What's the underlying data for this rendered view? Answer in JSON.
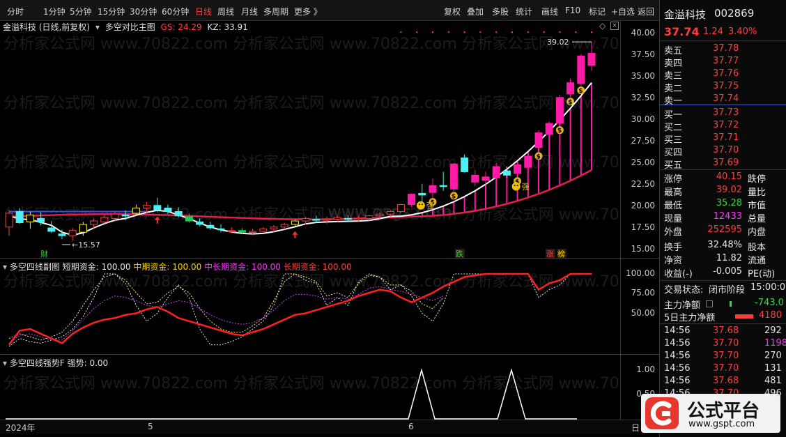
{
  "toolbar": {
    "periods": [
      "分时",
      "1分钟",
      "5分钟",
      "15分钟",
      "30分钟",
      "60分钟",
      "日线",
      "周线",
      "月线",
      "多周期",
      "更多 》"
    ],
    "active_period": "日线",
    "actions": [
      "复权",
      "叠加",
      "多股",
      "统计",
      "画线",
      "F10",
      "标记",
      "+自选",
      "返回"
    ]
  },
  "main_chart": {
    "stock_label": "金溢科技 (日线,前复权)",
    "indicator_name": "多空对比主图",
    "gs_label": "GS: 24.29",
    "kz_label": "KZ: 33.91",
    "high_marker": "39.02",
    "low_marker": "15.57",
    "qiang_label": "强",
    "y_ticks": [
      "40.00",
      "37.50",
      "35.00",
      "32.50",
      "30.00",
      "27.50",
      "25.00",
      "22.50",
      "20.00",
      "17.50",
      "15.00"
    ],
    "y_range": [
      15.0,
      40.0
    ],
    "event_labels": [
      "财",
      "跌",
      "涨",
      "榜"
    ],
    "watermark": "分析家公式网 www.70822.com",
    "watermark2": "www.gsgs.com",
    "candles": [
      [
        17.6,
        19.6,
        16.6,
        19.2
      ],
      [
        19.4,
        19.8,
        18.0,
        18.1
      ],
      [
        18.2,
        19.4,
        17.4,
        19.0
      ],
      [
        18.6,
        19.3,
        17.8,
        18.2
      ],
      [
        17.5,
        18.3,
        16.9,
        17.1
      ],
      [
        16.8,
        17.3,
        16.2,
        16.6
      ],
      [
        16.6,
        17.5,
        16.0,
        17.2
      ],
      [
        17.0,
        18.2,
        16.6,
        17.9
      ],
      [
        17.9,
        18.6,
        17.4,
        18.3
      ],
      [
        18.2,
        19.0,
        17.8,
        18.7
      ],
      [
        18.6,
        19.4,
        18.2,
        19.1
      ],
      [
        19.0,
        19.5,
        18.4,
        18.9
      ],
      [
        19.2,
        20.2,
        18.9,
        19.8
      ],
      [
        19.8,
        20.5,
        19.2,
        20.1
      ],
      [
        20.1,
        21.0,
        19.3,
        19.6
      ],
      [
        19.8,
        20.2,
        19.1,
        19.4
      ],
      [
        19.4,
        19.9,
        18.7,
        18.9
      ],
      [
        18.8,
        19.2,
        18.1,
        18.3
      ],
      [
        18.2,
        18.6,
        17.7,
        17.9
      ],
      [
        17.8,
        18.2,
        17.3,
        17.5
      ],
      [
        17.4,
        17.9,
        17.0,
        17.3
      ],
      [
        17.2,
        17.6,
        16.9,
        17.2
      ],
      [
        17.2,
        17.5,
        16.8,
        17.0
      ],
      [
        17.0,
        17.4,
        16.7,
        17.1
      ],
      [
        17.1,
        17.6,
        16.9,
        17.4
      ],
      [
        17.4,
        17.8,
        17.0,
        17.6
      ],
      [
        17.6,
        18.1,
        17.3,
        17.9
      ],
      [
        17.9,
        18.5,
        17.6,
        18.3
      ],
      [
        18.3,
        18.8,
        17.9,
        18.6
      ],
      [
        18.5,
        18.9,
        18.1,
        18.4
      ],
      [
        18.4,
        18.8,
        18.0,
        18.5
      ],
      [
        18.5,
        18.9,
        18.2,
        18.7
      ],
      [
        18.6,
        19.0,
        18.2,
        18.5
      ],
      [
        18.5,
        18.9,
        18.2,
        18.6
      ],
      [
        18.6,
        19.0,
        18.3,
        18.9
      ],
      [
        18.9,
        19.3,
        18.5,
        19.1
      ],
      [
        19.1,
        19.6,
        18.8,
        19.4
      ],
      [
        19.4,
        20.3,
        19.2,
        20.2
      ],
      [
        20.2,
        21.5,
        19.9,
        21.4
      ],
      [
        21.5,
        22.6,
        20.5,
        21.3
      ],
      [
        21.6,
        23.2,
        21.0,
        22.4
      ],
      [
        22.4,
        24.0,
        21.8,
        22.3
      ],
      [
        22.0,
        25.0,
        21.7,
        24.9
      ],
      [
        25.6,
        26.0,
        23.9,
        24.0
      ],
      [
        22.8,
        24.2,
        22.3,
        23.6
      ],
      [
        23.0,
        24.0,
        22.4,
        23.4
      ],
      [
        23.3,
        25.0,
        22.8,
        24.6
      ],
      [
        24.1,
        24.6,
        23.3,
        23.6
      ],
      [
        23.8,
        25.2,
        23.4,
        24.8
      ],
      [
        24.5,
        26.2,
        24.0,
        25.8
      ],
      [
        26.8,
        28.8,
        26.3,
        28.5
      ],
      [
        28.3,
        29.8,
        27.5,
        29.6
      ],
      [
        29.6,
        32.9,
        29.3,
        32.6
      ],
      [
        33.0,
        34.8,
        32.6,
        34.3
      ],
      [
        34.2,
        37.6,
        33.9,
        37.4
      ],
      [
        36.3,
        39.0,
        35.7,
        37.7
      ]
    ]
  },
  "sub_chart1": {
    "title": "多空四线副图",
    "short_label": "短期资金: 100.00",
    "mid_label": "中期资金: 100.00",
    "midlong_label": "中长期资金: 100.00",
    "long_label": "长期资金: 100.00",
    "y_ticks": [
      "100.00",
      "75.00",
      "50.00"
    ]
  },
  "sub_chart2": {
    "title": "多空四线强势F",
    "strength_label": "强势: 0.00",
    "y_ticks": [
      "1.00",
      "0.50"
    ]
  },
  "date_axis": [
    "2024年",
    "5",
    "6",
    "日"
  ],
  "right_panel": {
    "stock_name": "金溢科技",
    "stock_code": "002869",
    "price": "37.74",
    "change": "1.24",
    "change_pct": "3.40%",
    "asks": [
      {
        "label": "卖五",
        "price": "37.78"
      },
      {
        "label": "卖四",
        "price": "37.77"
      },
      {
        "label": "卖三",
        "price": "37.76"
      },
      {
        "label": "卖二",
        "price": "37.75"
      },
      {
        "label": "卖一",
        "price": "37.74"
      }
    ],
    "bids": [
      {
        "label": "买一",
        "price": "37.73"
      },
      {
        "label": "买二",
        "price": "37.72"
      },
      {
        "label": "买三",
        "price": "37.71"
      },
      {
        "label": "买四",
        "price": "37.70"
      },
      {
        "label": "买五",
        "price": "37.69"
      }
    ],
    "stats": [
      {
        "l1": "涨停",
        "v1": "40.15",
        "c1": "red",
        "l2": "跌停"
      },
      {
        "l1": "最高",
        "v1": "39.02",
        "c1": "red",
        "l2": "量比"
      },
      {
        "l1": "最低",
        "v1": "35.28",
        "c1": "green",
        "l2": "市值"
      },
      {
        "l1": "现量",
        "v1": "12433",
        "c1": "magenta",
        "l2": "总量"
      },
      {
        "l1": "外盘",
        "v1": "252595",
        "c1": "red",
        "l2": "内盘"
      },
      {
        "l1": "换手",
        "v1": "32.48%",
        "c1": "white",
        "l2": "股本"
      },
      {
        "l1": "净资",
        "v1": "11.82",
        "c1": "white",
        "l2": "流通"
      },
      {
        "l1": "收益(-)",
        "v1": "-0.005",
        "c1": "white",
        "l2": "PE(动)"
      }
    ],
    "trade_status_label": "交易状态:",
    "trade_status_value": "闭市阶段",
    "trade_time": "15:00:0",
    "main_net_label": "主力净额",
    "main_net_value": "-743.0",
    "five_day_label": "5日主力净额",
    "five_day_value": "4180",
    "ticks": [
      {
        "time": "14:56",
        "price": "37.68",
        "vol": "292",
        "vc": "white"
      },
      {
        "time": "14:56",
        "price": "37.70",
        "vol": "1198",
        "vc": "magenta"
      },
      {
        "time": "14:56",
        "price": "37.70",
        "vol": "270",
        "vc": "white"
      },
      {
        "time": "14:56",
        "price": "37.70",
        "vol": "131",
        "vc": "white"
      },
      {
        "time": "14:56",
        "price": "37.68",
        "vol": "481",
        "vc": "white"
      },
      {
        "time": "14:56",
        "price": "37.70",
        "vol": "496",
        "vc": "white"
      }
    ]
  },
  "logo": {
    "title": "公式平台",
    "url": "www.gspt.com"
  },
  "colors": {
    "up": "#ff3c3c",
    "down": "#4cf0f0",
    "hot": "#ff1aa8",
    "short_line": "#e6e6e6",
    "mid_line": "#ffee66",
    "midlong_line": "#c040ff",
    "long_line": "#ff2020"
  }
}
